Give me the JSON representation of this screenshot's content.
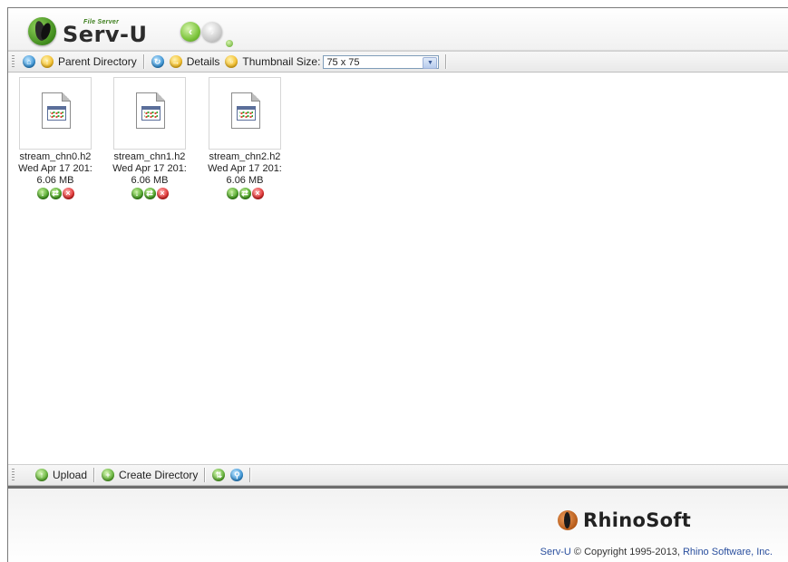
{
  "header": {
    "product_small": "File Server",
    "product_name": "Serv-U",
    "back_icon": "back-arrow-icon",
    "forward_icon": "forward-arrow-icon"
  },
  "toolbar_top": {
    "parent_directory": "Parent Directory",
    "details": "Details",
    "thumbnail_size_label": "Thumbnail Size:",
    "thumbnail_size_value": "75 x 75"
  },
  "files": [
    {
      "name": "stream_chn0.h2",
      "date": "Wed Apr 17 201:",
      "size": "6.06 MB"
    },
    {
      "name": "stream_chn1.h2",
      "date": "Wed Apr 17 201:",
      "size": "6.06 MB"
    },
    {
      "name": "stream_chn2.h2",
      "date": "Wed Apr 17 201:",
      "size": "6.06 MB"
    }
  ],
  "toolbar_bottom": {
    "upload": "Upload",
    "create_directory": "Create Directory"
  },
  "footer": {
    "brand": "RhinoSoft",
    "copyright_product": "Serv-U",
    "copyright_text": " © Copyright 1995-2013, ",
    "copyright_company": "Rhino Software, Inc."
  },
  "colors": {
    "accent_green": "#55a92a",
    "link_blue": "#2a4f9e",
    "toolbar_bg": "#e9e9e9"
  }
}
